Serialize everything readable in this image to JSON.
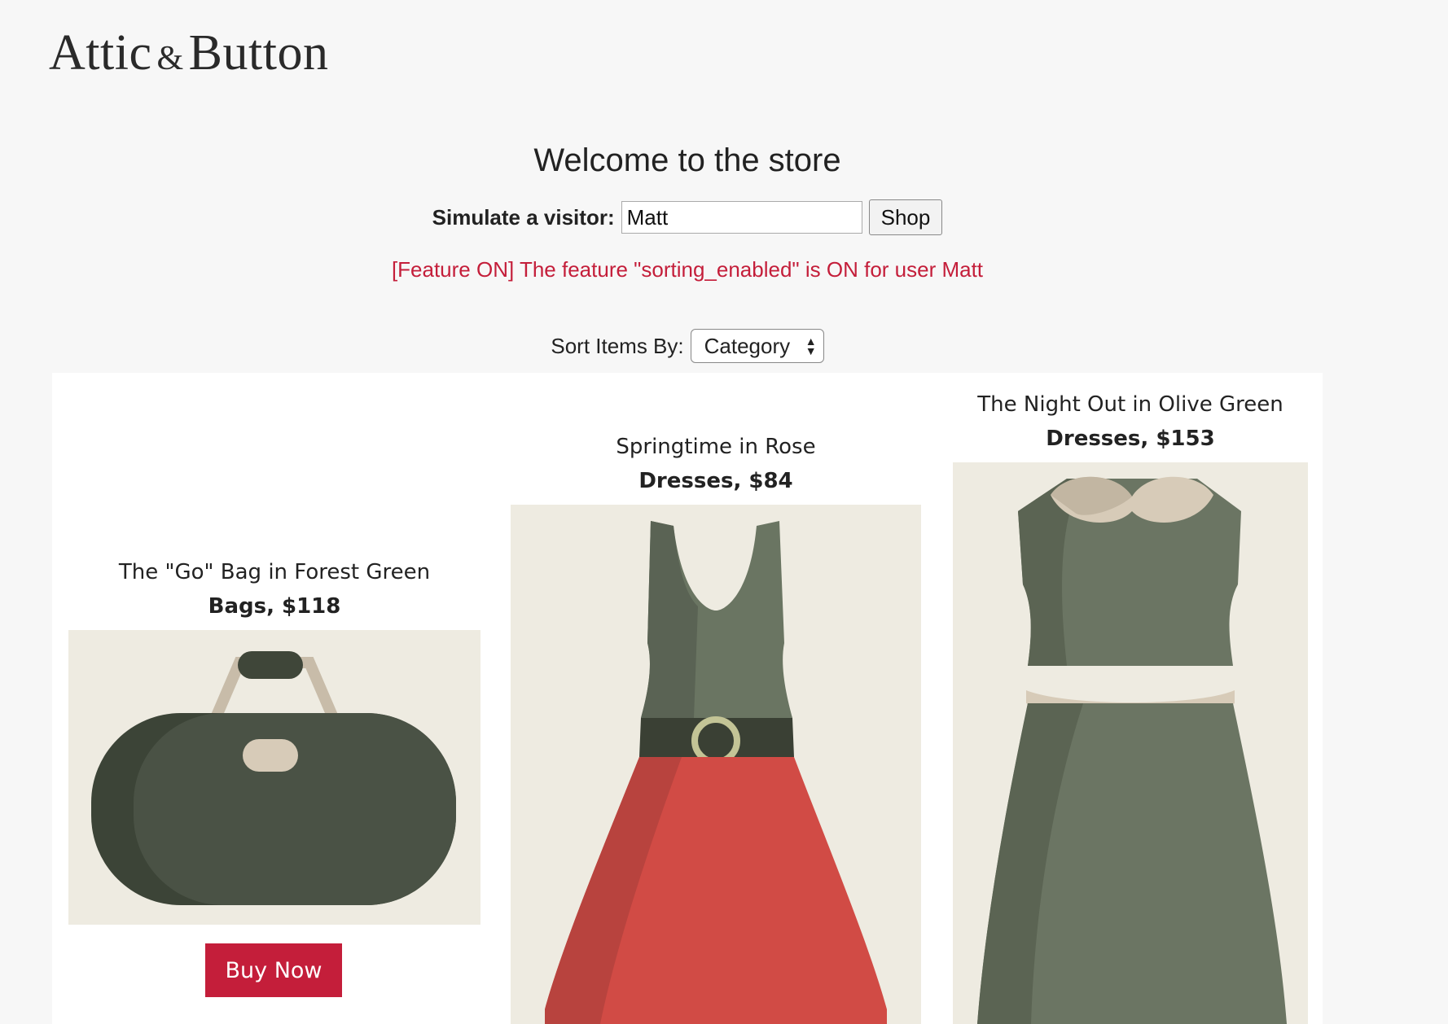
{
  "brand": {
    "logo_left": "Attic",
    "logo_amp": "&",
    "logo_right": "Button"
  },
  "header": {
    "welcome": "Welcome to the store"
  },
  "visitor": {
    "label": "Simulate a visitor:",
    "value": "Matt",
    "button": "Shop"
  },
  "feature": {
    "message": "[Feature ON] The feature \"sorting_enabled\" is ON for user Matt"
  },
  "sort": {
    "label": "Sort Items By:",
    "selected": "Category"
  },
  "products": [
    {
      "name": "The \"Go\" Bag in Forest Green",
      "meta": "Bags, $118",
      "buy": "Buy Now"
    },
    {
      "name": "Springtime in Rose",
      "meta": "Dresses, $84"
    },
    {
      "name": "The Night Out in Olive Green",
      "meta": "Dresses, $153"
    }
  ],
  "colors": {
    "accent": "#c41e3a",
    "card_bg": "#eeebe1",
    "page_bg": "#f7f7f7"
  }
}
